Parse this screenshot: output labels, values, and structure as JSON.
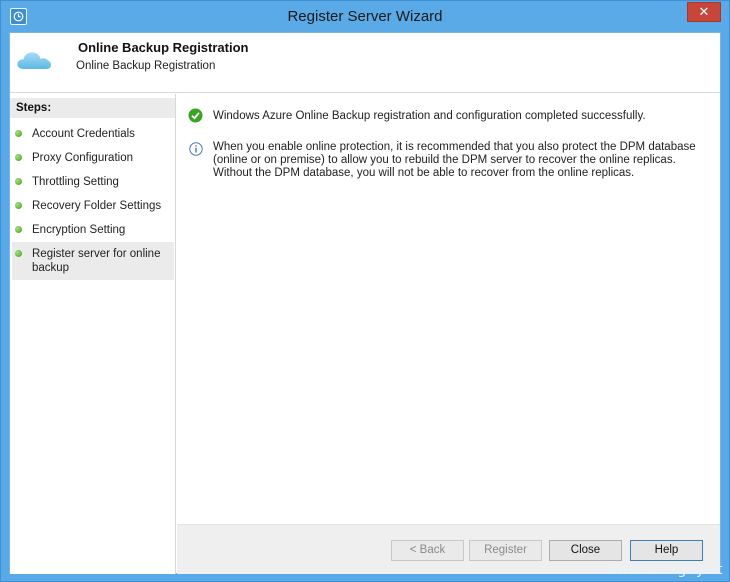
{
  "window": {
    "title": "Register Server Wizard",
    "close_glyph": "✕",
    "app_icon": "clock-icon"
  },
  "header": {
    "icon": "cloud-icon",
    "title": "Online Backup Registration",
    "subtitle": "Online Backup Registration"
  },
  "sidebar": {
    "steps_label": "Steps:",
    "items": [
      {
        "label": "Account Credentials"
      },
      {
        "label": "Proxy Configuration"
      },
      {
        "label": "Throttling Setting"
      },
      {
        "label": "Recovery Folder Settings"
      },
      {
        "label": "Encryption Setting"
      },
      {
        "label": "Register server for online backup",
        "active": true
      }
    ]
  },
  "content": {
    "success_message": "Windows Azure Online Backup registration and configuration completed successfully.",
    "info_message": "When you enable online protection, it is recommended that you also protect the DPM database (online or on premise) to allow you to rebuild the DPM server to recover the online replicas. Without the DPM database, you will not be able to recover from the online replicas."
  },
  "buttons": {
    "back": "< Back",
    "register": "Register",
    "close": "Close",
    "help": "Help"
  },
  "watermark": "www.techguy.at"
}
